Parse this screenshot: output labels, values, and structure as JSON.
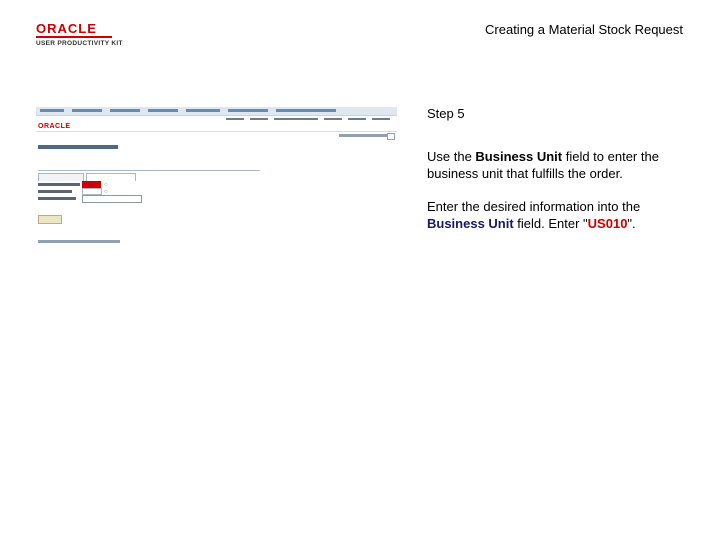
{
  "logo": {
    "brand": "ORACLE",
    "product": "USER PRODUCTIVITY KIT"
  },
  "document": {
    "title": "Creating a Material Stock Request"
  },
  "step": {
    "label": "Step 5"
  },
  "instruction": {
    "line1_prefix": "Use the ",
    "line1_field": "Business Unit",
    "line1_suffix": " field to enter the business unit that fulfills the order.",
    "line2_prefix": "Enter the desired information into the ",
    "line2_field": "Business Unit",
    "line2_middle": " field. Enter \"",
    "line2_value": "US010",
    "line2_suffix": "\"."
  },
  "colors": {
    "brand_red": "#cc0000",
    "field_name": "#1a1a5e"
  }
}
